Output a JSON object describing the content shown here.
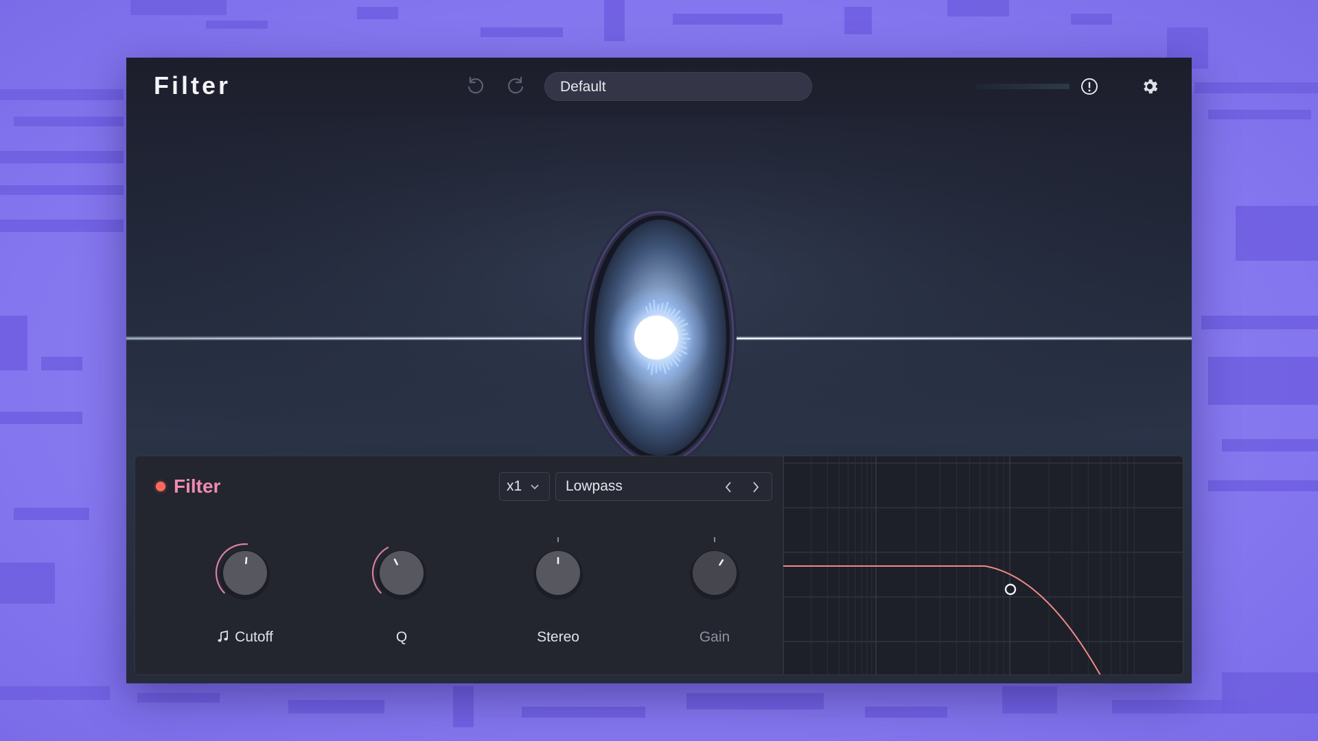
{
  "app": {
    "title": "Filter",
    "preset_name": "Default"
  },
  "toolbar": {
    "undo_icon": "undo-icon",
    "redo_icon": "redo-icon",
    "alert_icon": "alert-circle-icon",
    "settings_icon": "gear-icon",
    "output_level": 0.95
  },
  "filter_section": {
    "title": "Filter",
    "enabled": true,
    "power_color": "#ff6a5a",
    "title_color": "#f08bb0",
    "oversample": "x1",
    "type": "Lowpass",
    "knobs": [
      {
        "label": "Cutoff",
        "icon": "music-note-icon",
        "value": 0.52,
        "active": true
      },
      {
        "label": "Q",
        "icon": "",
        "value": 0.4,
        "active": true
      },
      {
        "label": "Stereo",
        "icon": "",
        "value": 0.5,
        "active": true
      },
      {
        "label": "Gain",
        "icon": "",
        "value": 0.62,
        "active": false
      }
    ]
  },
  "graph": {
    "curve_color": "#f08c86",
    "handle_icon": "filter-handle"
  },
  "colors": {
    "background": "#8a7cf0",
    "panel": "#23252f",
    "accent": "#f08bb0"
  }
}
